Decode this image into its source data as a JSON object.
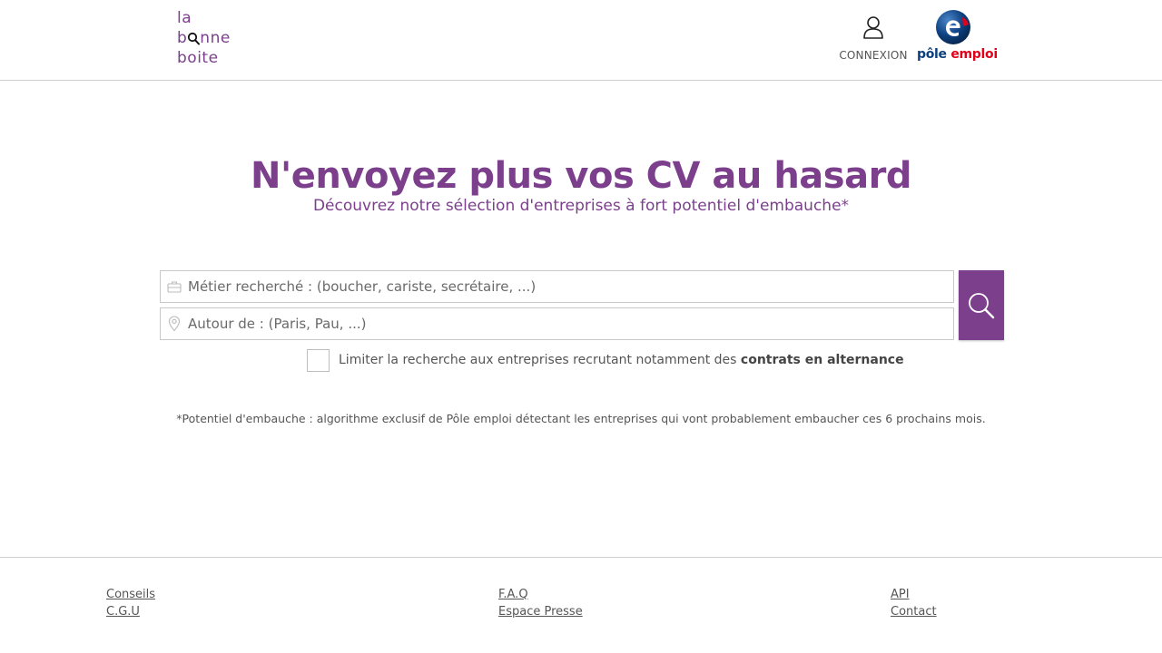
{
  "header": {
    "logo": {
      "line1": "la",
      "line2_a": "b",
      "line2_b": "nne",
      "line3": "boite"
    },
    "connexion_label": "CONNEXION",
    "pe_logo": {
      "part1": "pôle",
      "part2": "emploi"
    }
  },
  "hero": {
    "title": "N'envoyez plus vos CV au hasard",
    "subtitle": "Découvrez notre sélection d'entreprises à fort potentiel d'embauche*"
  },
  "search": {
    "job_placeholder": "Métier recherché : (boucher, cariste, secrétaire, ...)",
    "job_value": "",
    "location_placeholder": "Autour de : (Paris, Pau, ...)",
    "location_value": "",
    "alternance": {
      "checked": false,
      "label_prefix": "Limiter la recherche aux entreprises recrutant notamment des ",
      "label_bold": "contrats en alternance"
    }
  },
  "note": "*Potentiel d'embauche : algorithme exclusif de Pôle emploi détectant les entreprises qui vont probablement embaucher ces 6 prochains mois.",
  "footer": {
    "col1": [
      "Conseils",
      "C.G.U"
    ],
    "col2": [
      "F.A.Q",
      "Espace Presse"
    ],
    "col3": [
      "API",
      "Contact"
    ]
  },
  "colors": {
    "brand": "#7b3f8c",
    "pe_blue": "#0c3f7e",
    "pe_red": "#e2001a"
  },
  "icons": [
    "magnifier-icon",
    "user-icon",
    "briefcase-icon",
    "location-pin-icon",
    "search-icon"
  ]
}
